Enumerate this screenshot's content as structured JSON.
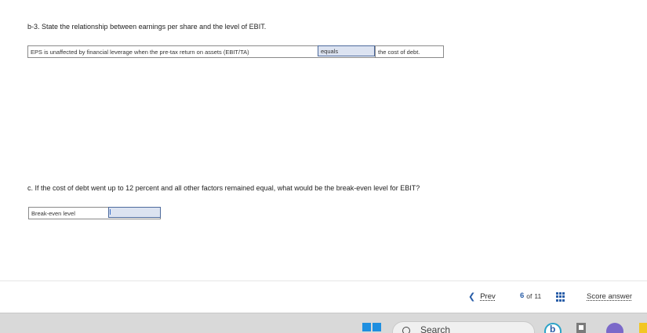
{
  "question_b3": {
    "prompt": "b-3. State the relationship between earnings per share and the level of EBIT.",
    "row": {
      "statement": "EPS is unaffected by financial leverage when the pre-tax return on assets (EBIT/TA)",
      "dropdown_value": "equals",
      "tail": "the cost of debt."
    }
  },
  "question_c": {
    "prompt": "c. If the cost of debt went up to 12 percent and all other factors remained equal, what would be the break-even level for EBIT?",
    "row": {
      "label": "Break-even level",
      "input_value": ""
    }
  },
  "footer": {
    "prev_label": "Prev",
    "page_current": "6",
    "page_of": "of",
    "page_total": "11",
    "score_label": "Score answer"
  },
  "taskbar": {
    "search_label": "Search"
  },
  "colors": {
    "accent": "#2a5ea8",
    "input_fill": "#dce3f1",
    "input_border": "#4d6a9c"
  }
}
